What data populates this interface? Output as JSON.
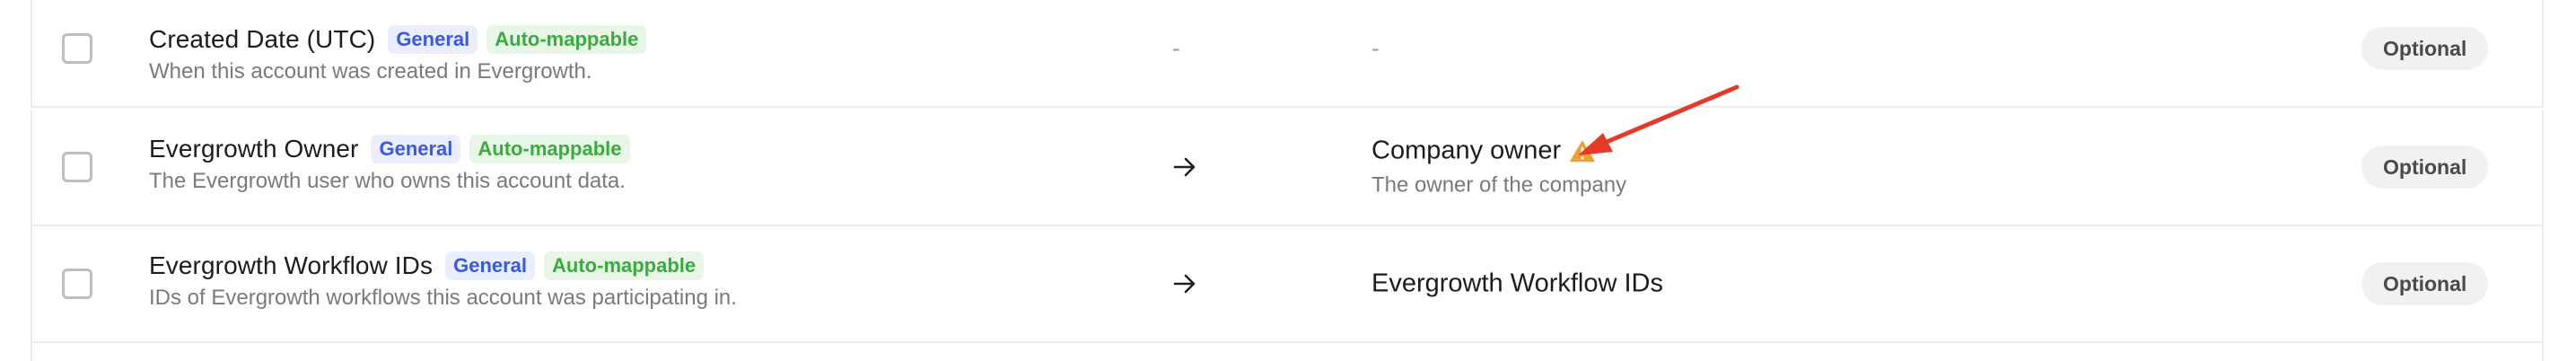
{
  "rows": [
    {
      "name": "Created Date (UTC)",
      "badges": [
        "General",
        "Auto-mappable"
      ],
      "description": "When this account was created in Evergrowth.",
      "mapping": "-",
      "target_name": "-",
      "requirement": "Optional"
    },
    {
      "name": "Evergrowth Owner",
      "badges": [
        "General",
        "Auto-mappable"
      ],
      "description": "The Evergrowth user who owns this account data.",
      "mapping_icon": "arrow-right-icon",
      "target_name": "Company owner",
      "target_icon": "warning-icon",
      "target_description": "The owner of the company",
      "requirement": "Optional"
    },
    {
      "name": "Evergrowth Workflow IDs",
      "badges": [
        "General",
        "Auto-mappable"
      ],
      "description": "IDs of Evergrowth workflows this account was participating in.",
      "mapping_icon": "arrow-right-icon",
      "target_name": "Evergrowth Workflow IDs",
      "requirement": "Optional"
    }
  ],
  "colors": {
    "general_badge_text": "#3a59e0",
    "general_badge_bg": "#eaeefe",
    "auto_badge_text": "#3cab3f",
    "auto_badge_bg": "#e8f6e8",
    "warning": "#f0a033",
    "annotation_arrow": "#e53a2a"
  },
  "annotation": {
    "type": "red-arrow",
    "points_to": "warning-icon"
  }
}
